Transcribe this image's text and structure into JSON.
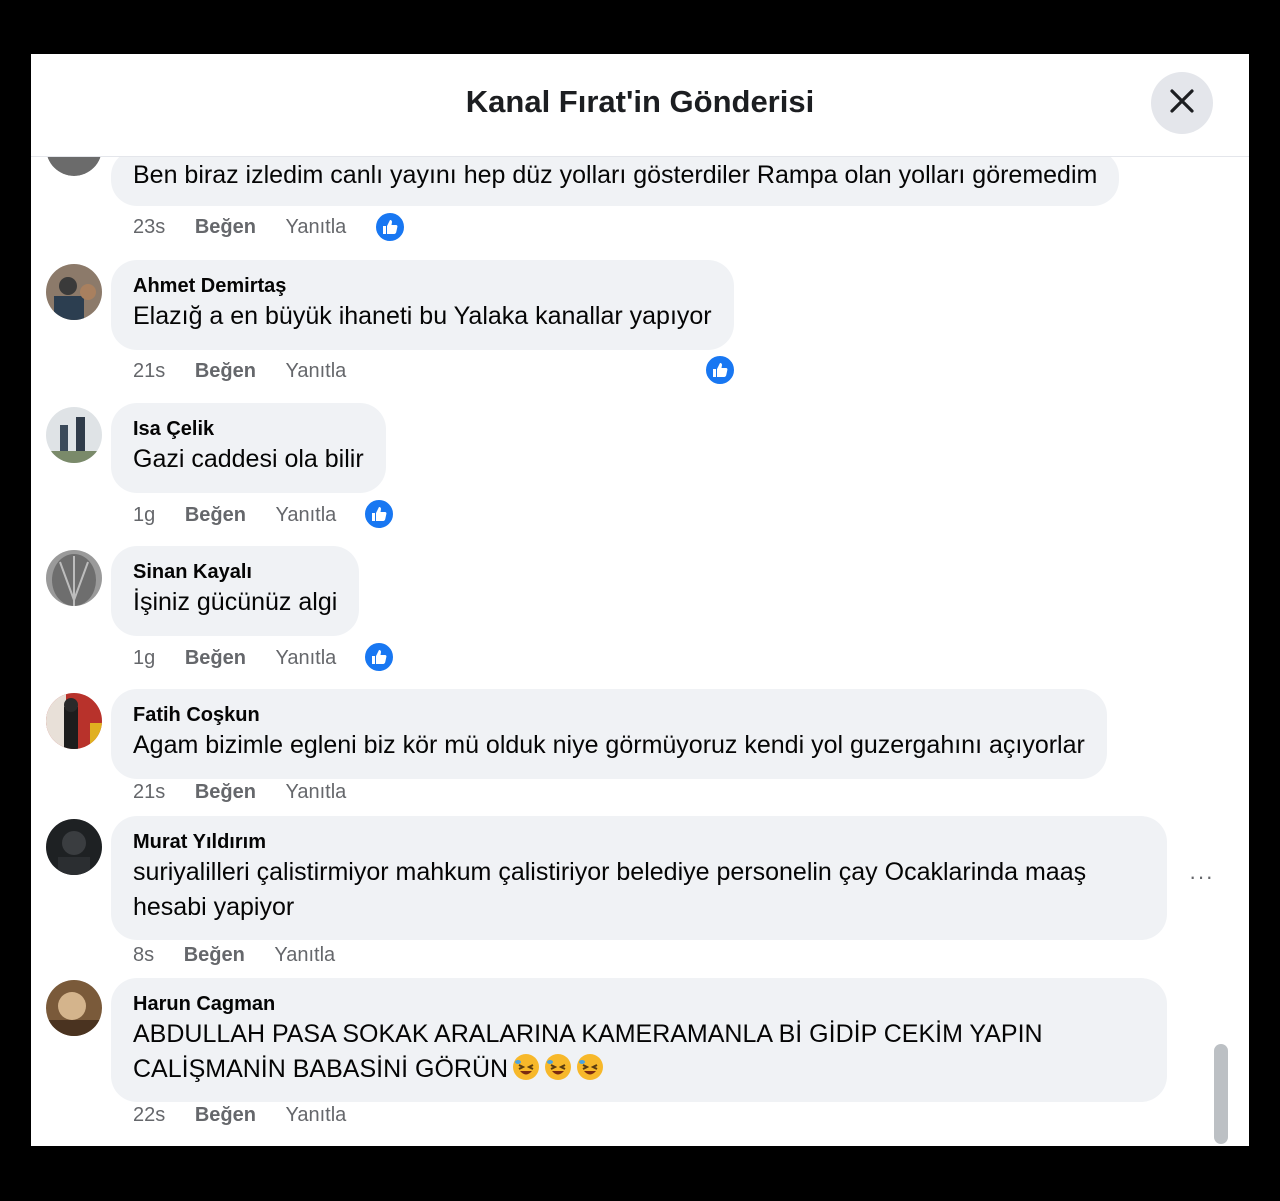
{
  "dialog": {
    "title": "Kanal Fırat'in Gönderisi",
    "close_icon": "close-icon"
  },
  "comments": [
    {
      "author": "",
      "text": "Ben biraz izledim canlı yayını hep düz yolları gösterdiler Rampa olan yolları göremedim",
      "time": "23s",
      "like_label": "Beğen",
      "reply_label": "Yanıtla",
      "has_like_reaction": true
    },
    {
      "author": "Ahmet Demirtaş",
      "text": "Elazığ a en büyük ihaneti bu Yalaka kanallar yapıyor",
      "time": "21s",
      "like_label": "Beğen",
      "reply_label": "Yanıtla",
      "has_like_reaction": true
    },
    {
      "author": "Isa Çelik",
      "text": "Gazi caddesi ola bilir",
      "time": "1g",
      "like_label": "Beğen",
      "reply_label": "Yanıtla",
      "has_like_reaction": true
    },
    {
      "author": "Sinan Kayalı",
      "text": "İşiniz gücünüz algi",
      "time": "1g",
      "like_label": "Beğen",
      "reply_label": "Yanıtla",
      "has_like_reaction": true
    },
    {
      "author": "Fatih Coşkun",
      "text": "Agam bizimle egleni biz kör mü olduk niye görmüyoruz kendi yol guzergahını açıyorlar",
      "time": "21s",
      "like_label": "Beğen",
      "reply_label": "Yanıtla",
      "has_like_reaction": false
    },
    {
      "author": "Murat Yıldırım",
      "text_line1": "suriyalilleri çalistirmiyor mahkum çalistiriyor belediye personelin çay Ocaklarinda maaş",
      "text_line2": "hesabi yapiyor",
      "time": "8s",
      "like_label": "Beğen",
      "reply_label": "Yanıtla",
      "more_label": "···",
      "has_like_reaction": false
    },
    {
      "author": "Harun Cagman",
      "text_line1": "ABDULLAH PASA SOKAK ARALARINA KAMERAMANLA Bİ GİDİP CEKİM YAPIN",
      "text_line2": "CALİŞMANİN BABASİNİ GÖRÜN",
      "emoji": "rolling-on-floor-laughing-emoji",
      "time": "22s",
      "like_label": "Beğen",
      "reply_label": "Yanıtla",
      "has_like_reaction": false
    }
  ],
  "colors": {
    "bubble": "#f0f2f5",
    "like_blue": "#1877f2",
    "meta_gray": "#65676b"
  }
}
